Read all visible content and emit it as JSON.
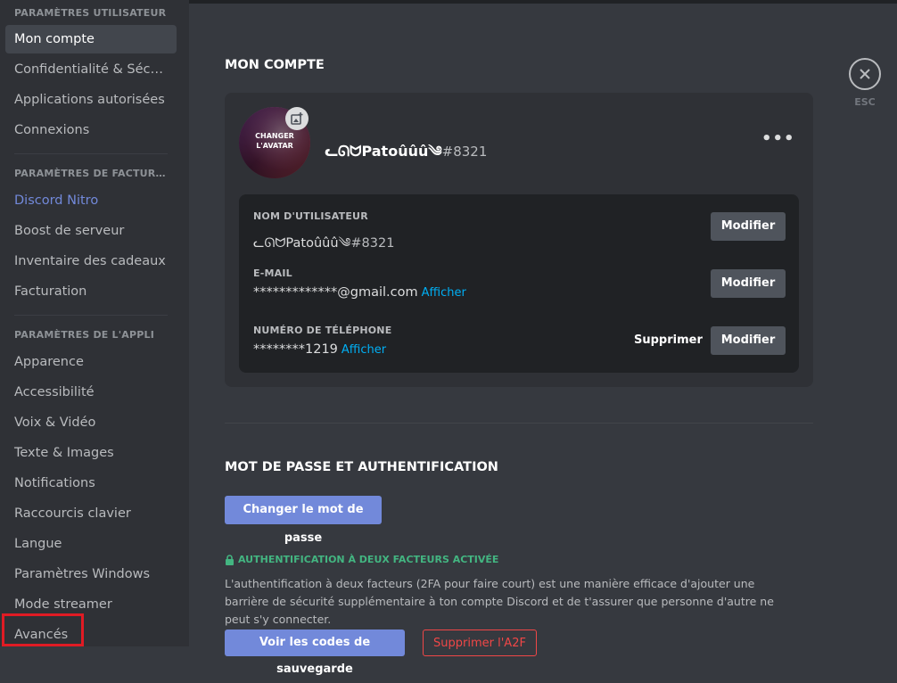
{
  "sidebar": {
    "user_settings_header": "PARAMÈTRES UTILISATEUR",
    "user_items": [
      {
        "label": "Mon compte"
      },
      {
        "label": "Confidentialité & Sécurité"
      },
      {
        "label": "Applications autorisées"
      },
      {
        "label": "Connexions"
      }
    ],
    "billing_header": "PARAMÈTRES DE FACTURATION",
    "billing_items": [
      {
        "label": "Discord Nitro"
      },
      {
        "label": "Boost de serveur"
      },
      {
        "label": "Inventaire des cadeaux"
      },
      {
        "label": "Facturation"
      }
    ],
    "app_header": "PARAMÈTRES DE L'APPLI",
    "app_items": [
      {
        "label": "Apparence"
      },
      {
        "label": "Accessibilité"
      },
      {
        "label": "Voix & Vidéo"
      },
      {
        "label": "Texte & Images"
      },
      {
        "label": "Notifications"
      },
      {
        "label": "Raccourcis clavier"
      },
      {
        "label": "Langue"
      },
      {
        "label": "Paramètres Windows"
      },
      {
        "label": "Mode streamer"
      },
      {
        "label": "Avancés"
      }
    ]
  },
  "account": {
    "title": "MON COMPTE",
    "avatar_overlay": "CHANGER L'AVATAR",
    "display_name": "ᓚᘏᗢPatoûûû༄",
    "discriminator": "#8321",
    "fields": {
      "username_label": "NOM D'UTILISATEUR",
      "username_name": "ᓚᘏᗢPatoûûû༄",
      "username_tag": "#8321",
      "email_label": "E-MAIL",
      "email_value": "*************@gmail.com",
      "email_reveal": "Afficher",
      "phone_label": "NUMÉRO DE TÉLÉPHONE",
      "phone_value": "********1219",
      "phone_reveal": "Afficher"
    },
    "edit_label": "Modifier",
    "remove_label": "Supprimer"
  },
  "security": {
    "title": "MOT DE PASSE ET AUTHENTIFICATION",
    "change_password": "Changer le mot de passe",
    "twofa_status": "AUTHENTIFICATION À DEUX FACTEURS ACTIVÉE",
    "description": "L'authentification à deux facteurs (2FA pour faire court) est une manière efficace d'ajouter une barrière de sécurité supplémentaire à ton compte Discord et de t'assurer que personne d'autre ne peut s'y connecter.",
    "view_backup_codes": "Voir les codes de sauvegarde",
    "remove_2fa": "Supprimer l'A2F"
  },
  "close": {
    "label": "ESC"
  },
  "colors": {
    "accent": "#7289da",
    "success": "#43b581",
    "danger": "#f04747",
    "link": "#00aff4"
  }
}
